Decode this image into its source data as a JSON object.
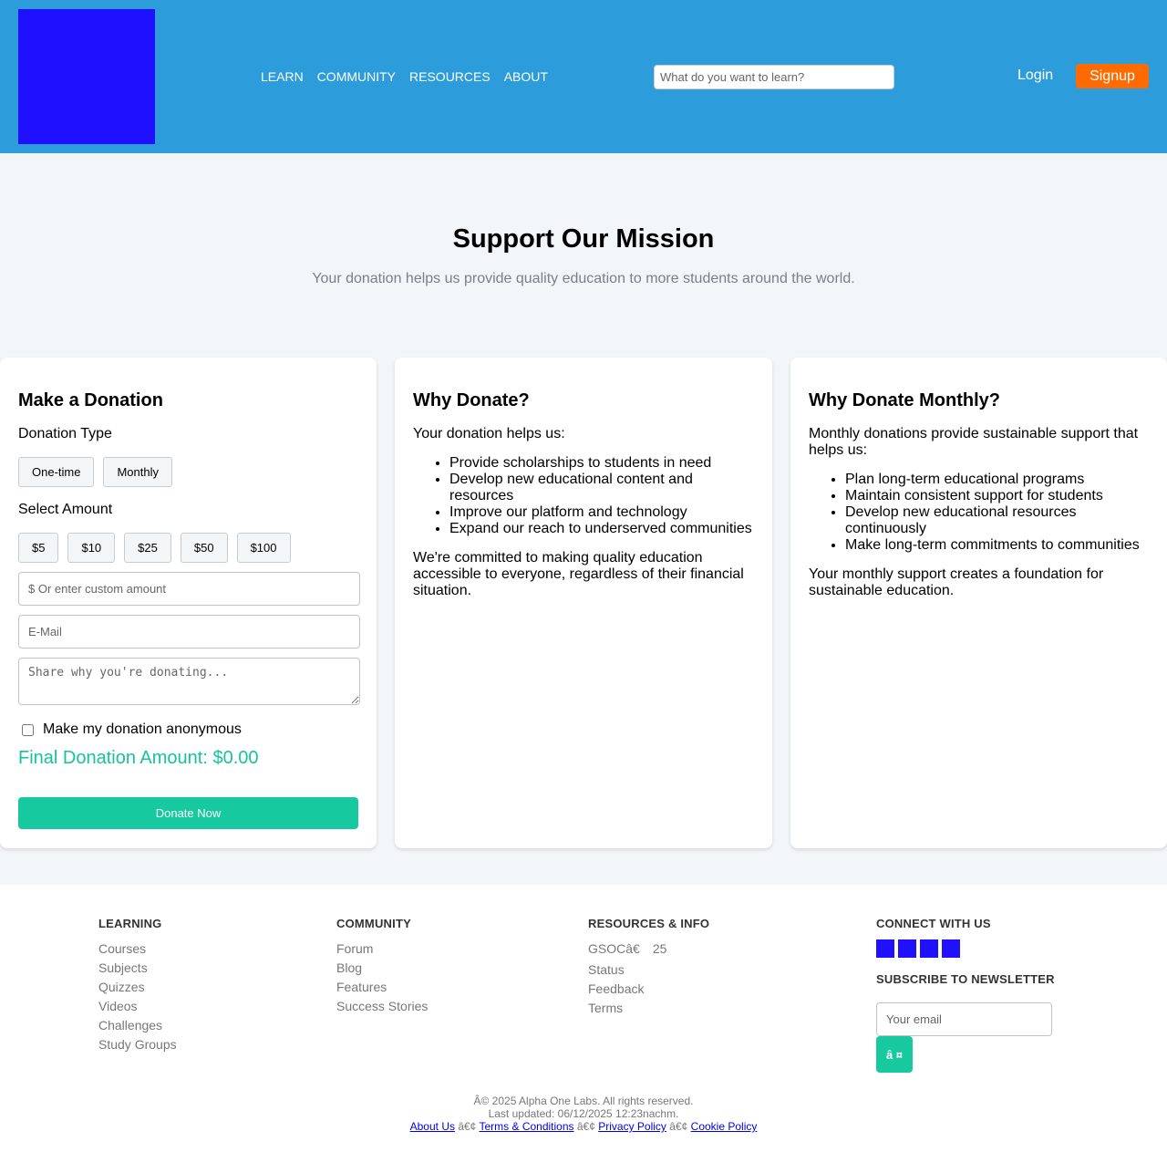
{
  "header": {
    "nav": [
      "LEARN",
      "COMMUNITY",
      "RESOURCES",
      "ABOUT"
    ],
    "search_placeholder": "What do you want to learn?",
    "login": "Login",
    "signup": "Signup"
  },
  "hero": {
    "title": "Support Our Mission",
    "subtitle": "Your donation helps us provide quality education to more students around the world."
  },
  "donation": {
    "title": "Make a Donation",
    "type_label": "Donation Type",
    "types": [
      "One-time",
      "Monthly"
    ],
    "amount_label": "Select Amount",
    "amounts": [
      "$5",
      "$10",
      "$25",
      "$50",
      "$100"
    ],
    "custom_placeholder": "$ Or enter custom amount",
    "email_placeholder": "E-Mail",
    "message_placeholder": "Share why you're donating...",
    "anonymous_label": "Make my donation anonymous",
    "final_amount": "Final Donation Amount: $0.00",
    "donate_button": "Donate Now"
  },
  "why_donate": {
    "title": "Why Donate?",
    "intro": "Your donation helps us:",
    "items": [
      "Provide scholarships to students in need",
      "Develop new educational content and resources",
      "Improve our platform and technology",
      "Expand our reach to underserved communities"
    ],
    "outro": "We're committed to making quality education accessible to everyone, regardless of their financial situation."
  },
  "why_monthly": {
    "title": "Why Donate Monthly?",
    "intro": "Monthly donations provide sustainable support that helps us:",
    "items": [
      "Plan long-term educational programs",
      "Maintain consistent support for students",
      "Develop new educational resources continuously",
      "Make long-term commitments to communities"
    ],
    "outro": "Your monthly support creates a foundation for sustainable education."
  },
  "footer": {
    "learning": {
      "title": "LEARNING",
      "links": [
        "Courses",
        "Subjects",
        "Quizzes",
        "Videos",
        "Challenges",
        "Study Groups"
      ]
    },
    "community": {
      "title": "COMMUNITY",
      "links": [
        "Forum",
        "Blog",
        "Features",
        "Success Stories"
      ]
    },
    "resources": {
      "title": "RESOURCES & INFO",
      "gsoc": [
        "GSOCâ€",
        "25"
      ],
      "links": [
        "Status",
        "Feedback",
        "Terms"
      ]
    },
    "connect": {
      "title": "CONNECT WITH US",
      "newsletter_title": "SUBSCRIBE TO NEWSLETTER",
      "email_placeholder": "Your email",
      "subscribe_button": "â ¤"
    },
    "copyright": "Â© 2025 Alpha One Labs. All rights reserved.",
    "updated": "Last updated: 06/12/2025 12:23nachm.",
    "sep": "â€¢",
    "legal": [
      "About Us",
      "Terms & Conditions",
      "Privacy Policy",
      "Cookie Policy"
    ]
  }
}
